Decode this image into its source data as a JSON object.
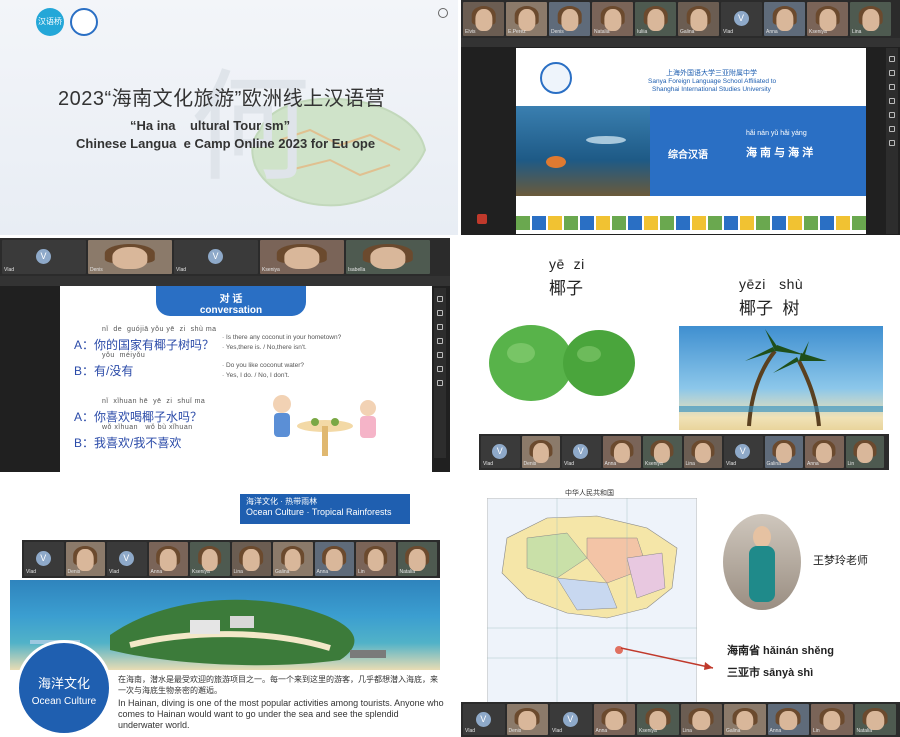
{
  "panel1": {
    "title_cn": "2023“海南文化旅游”欧洲线上汉语营",
    "title_en_1": "“Ha ina    ultural Tour sm”",
    "title_en_2": "Chinese Langua  e Camp Online 2023 for Eu ope",
    "logo_label": "汉语桥"
  },
  "panel2": {
    "school_cn": "上海外国语大学三亚附属中学",
    "school_en_1": "Sanya Foreign Language School Affiliated to",
    "school_en_2": "Shanghai International Studies University",
    "course": "综合汉语",
    "lesson_pinyin": "hǎi nán yǔ hǎi yáng",
    "lesson_cn": "海 南 与 海 洋",
    "participants": [
      "Elvis",
      "E.Perez",
      "Denis",
      "Natalia",
      "Iuliia",
      "Galina",
      "Vlad",
      "Anna",
      "Kseniya",
      "Lina"
    ]
  },
  "panel3": {
    "header_cn": "对 话",
    "header_en": "conversation",
    "q1_pinyin": "nǐ  de  guójiā yǒu yē  zi  shù ma",
    "q1": "A：你的国家有椰子树吗？",
    "q1_en_1": "· Is there any coconut in your hometown?",
    "q1_en_2": "· Yes,there is. / No,there isn't.",
    "a1_pinyin": "yǒu  méiyǒu",
    "a1": "B：有/没有",
    "q2_pinyin": "nǐ  xǐhuan hē  yē  zi  shuǐ ma",
    "q2": "A：你喜欢喝椰子水吗？",
    "q2_en_1": "· Do you like coconut water?",
    "q2_en_2": "· Yes, I do. / No, I don't.",
    "a2_pinyin": "wǒ xǐhuan   wǒ bù xǐhuan",
    "a2": "B：我喜欢/我不喜欢",
    "participants": [
      "Vlad",
      "Denis",
      "Vlad",
      "Kseniya",
      "Isabella"
    ]
  },
  "panel4": {
    "coconut_pinyin": "yē  zi",
    "coconut_cn": "椰子",
    "tree_pinyin": "yēzi   shù",
    "tree_cn": "椰子  树",
    "participants": [
      "Vlad",
      "Denis",
      "Vlad",
      "Anna",
      "Kseniya",
      "Lina",
      "Vlad",
      "Galina",
      "Anna",
      "Lin"
    ]
  },
  "panel5": {
    "banner_cn": "海洋文化 · 热带雨林",
    "banner_en": "Ocean Culture · Tropical Rainforests",
    "badge_cn": "海洋文化",
    "badge_en": "Ocean Culture",
    "body_cn": "在海南，潜水是最受欢迎的旅游项目之一。每一个来到这里的游客，几乎都想潜入海底，来一次与海底生物亲密的邂逅。",
    "body_en": "In Hainan, diving is one of the most popular activities among tourists. Anyone who comes to Hainan would want to go under the sea and see the splendid underwater world.",
    "participants": [
      "Vlad",
      "Denis",
      "Vlad",
      "Anna",
      "Kseniya",
      "Lina",
      "Galina",
      "Anna",
      "Lin",
      "Natalia"
    ]
  },
  "panel6": {
    "map_title": "中华人民共和国",
    "teacher": "王梦玲老师",
    "province": "海南省 hǎinán shěng",
    "city": "三亚市 sānyà shì",
    "participants": [
      "Vlad",
      "Denis",
      "Vlad",
      "Anna",
      "Kseniya",
      "Lina",
      "Galina",
      "Anna",
      "Lin",
      "Natalia"
    ]
  },
  "colors": {
    "accent_blue": "#1f5fb0",
    "slide_blue": "#2a6fc4",
    "sea": "#2d8fc4"
  }
}
